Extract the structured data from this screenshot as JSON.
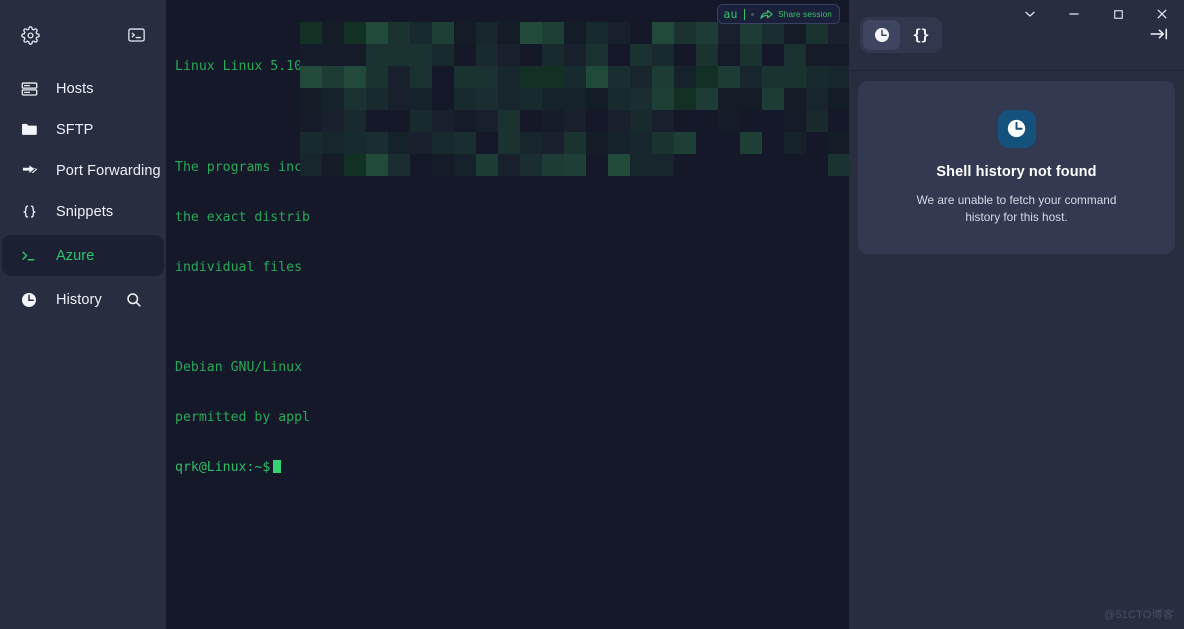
{
  "sidebar": {
    "settings_icon": "gear-icon",
    "new_terminal_icon": "terminal-icon",
    "items": [
      {
        "label": "Hosts",
        "icon": "server-icon",
        "active": false
      },
      {
        "label": "SFTP",
        "icon": "folder-icon",
        "active": false
      },
      {
        "label": "Port Forwarding",
        "icon": "arrows-icon",
        "active": false
      },
      {
        "label": "Snippets",
        "icon": "braces-icon",
        "active": false
      },
      {
        "label": "Azure",
        "icon": "prompt-icon",
        "active": true
      },
      {
        "label": "History",
        "icon": "clock-icon",
        "active": false
      }
    ],
    "search_icon": "search-icon"
  },
  "terminal": {
    "lines": [
      "Linux Linux 5.10.",
      "",
      "The programs incl",
      "the exact distrib",
      "individual files",
      "",
      "Debian GNU/Linux",
      "permitted by appl"
    ],
    "prompt": "qrk@Linux:~$",
    "cursor": "block-cursor"
  },
  "share_pill": {
    "session_name": "au",
    "share_label": "Share session",
    "share_icon": "share-arrow-icon"
  },
  "window_controls": [
    {
      "name": "chevron-down-icon",
      "label": "chevron-down"
    },
    {
      "name": "minimize-icon",
      "label": "minimize"
    },
    {
      "name": "maximize-icon",
      "label": "maximize"
    },
    {
      "name": "close-icon",
      "label": "close"
    }
  ],
  "collapse_panel": {
    "icon": "collapse-right-icon"
  },
  "panel": {
    "tabs": [
      {
        "icon": "clock-icon",
        "active": true
      },
      {
        "icon": "braces-icon",
        "active": false,
        "glyph": "{}"
      }
    ],
    "empty_state": {
      "icon": "clock-icon",
      "title": "Shell history not found",
      "message": "We are unable to fetch your command history for this host."
    }
  },
  "watermark": "@51CTO博客",
  "colors": {
    "sidebar_bg": "#282d40",
    "terminal_bg": "#141828",
    "accent_green": "#2fc46b",
    "active_nav_bg": "#1b2032",
    "card_bg": "#333950",
    "icon_blue": "#14517d"
  }
}
